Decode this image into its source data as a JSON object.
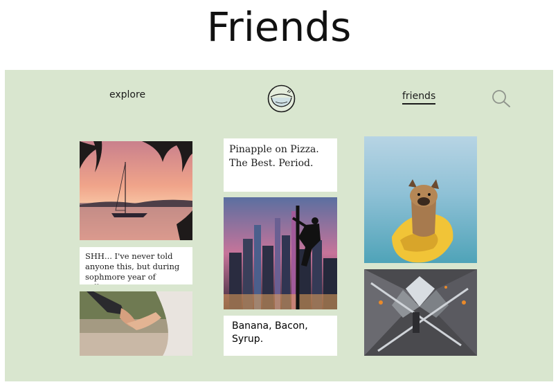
{
  "page": {
    "title": "Friends"
  },
  "nav": {
    "explore_label": "explore",
    "friends_label": "friends",
    "logo_icon": "bowl-logo-icon",
    "search_icon": "search-icon"
  },
  "colors": {
    "panel_background": "#d9e6cf",
    "card_background": "#ffffff",
    "text": "#1a1a1a"
  },
  "feed": {
    "column_1": {
      "post_1": {
        "type": "image",
        "subject": "sailboat at sunset under palm leaves"
      },
      "post_2": {
        "type": "text",
        "text": "SHH... I've never told anyone this, but during sophmore year of college...."
      },
      "post_3": {
        "type": "image",
        "subject": "two people holding hands"
      }
    },
    "column_2": {
      "post_1": {
        "type": "text",
        "text": "Pinapple on Pizza. The Best. Period."
      },
      "post_2": {
        "type": "image",
        "subject": "person climbing pole over night city skyline"
      },
      "post_3": {
        "type": "text",
        "text": "Banana, Bacon, Syrup."
      }
    },
    "column_3": {
      "post_1": {
        "type": "image",
        "subject": "french bulldog on yellow kayak"
      },
      "post_2": {
        "type": "image",
        "subject": "escalators in modern building atrium"
      }
    }
  }
}
